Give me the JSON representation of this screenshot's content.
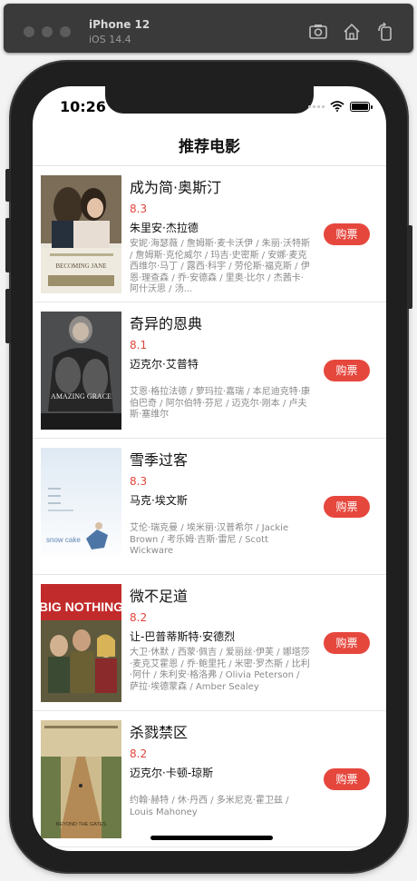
{
  "simulator": {
    "device_name": "iPhone 12",
    "os_version": "iOS 14.4",
    "icons": [
      "screenshot-icon",
      "home-icon",
      "rotate-icon"
    ]
  },
  "status_bar": {
    "time": "10:26"
  },
  "nav": {
    "title": "推荐电影"
  },
  "movies": [
    {
      "title": "成为简·奥斯汀",
      "rating": "8.3",
      "director": "朱里安·杰拉德",
      "cast": "安妮·海瑟薇 / 詹姆斯·麦卡沃伊 / 朱丽·沃特斯 / 詹姆斯·克伦威尔 / 玛吉·史密斯 / 安娜·麦克西维尔·马丁 / 露西·科宇 / 劳伦斯·福克斯 / 伊恩·理查森 / 乔·安德森 / 里奥·比尔 / 杰茜卡·阿什沃思 / 汤...",
      "buy_label": "购票",
      "poster_text": "BECOMING JANE"
    },
    {
      "title": "奇异的恩典",
      "rating": "8.1",
      "director": "迈克尔·艾普特",
      "cast": "艾恩·格拉法德 / 萝玛拉·嘉瑞 / 本尼迪克特·康伯巴奇 / 阿尔伯特·芬尼 / 迈克尔·刚本 / 卢夫斯·塞维尔",
      "buy_label": "购票",
      "poster_text": "AMAZING GRACE"
    },
    {
      "title": "雪季过客",
      "rating": "8.3",
      "director": "马克·埃文斯",
      "cast": "艾伦·瑞克曼 / 埃米丽·汉普希尔 / Jackie Brown / 考乐姆·吉斯·雷尼 / Scott Wickware",
      "buy_label": "购票",
      "poster_text": "snow cake"
    },
    {
      "title": "微不足道",
      "rating": "8.2",
      "director": "让-巴普蒂斯特·安德烈",
      "cast": "大卫·休默 / 西蒙·佩吉 / 爱丽丝·伊芙 / 娜塔莎·麦克艾霍恩 / 乔·鲍里托 / 米密·罗杰斯 / 比利·阿什 / 朱利安·格洛弗 / Olivia Peterson / 萨拉·埃德蒙森 / Amber Sealey",
      "buy_label": "购票",
      "poster_text": "BIG NOTHING"
    },
    {
      "title": "杀戮禁区",
      "rating": "8.2",
      "director": "迈克尔·卡顿-琼斯",
      "cast": "约翰·赫特 / 休·丹西 / 多米尼克·霍卫兹 / Louis Mahoney",
      "buy_label": "购票",
      "poster_text": "BEYOND THE GATES"
    }
  ],
  "colors": {
    "accent": "#e6473d",
    "rating": "#e0453b",
    "cast_text": "#8a8a8a"
  }
}
